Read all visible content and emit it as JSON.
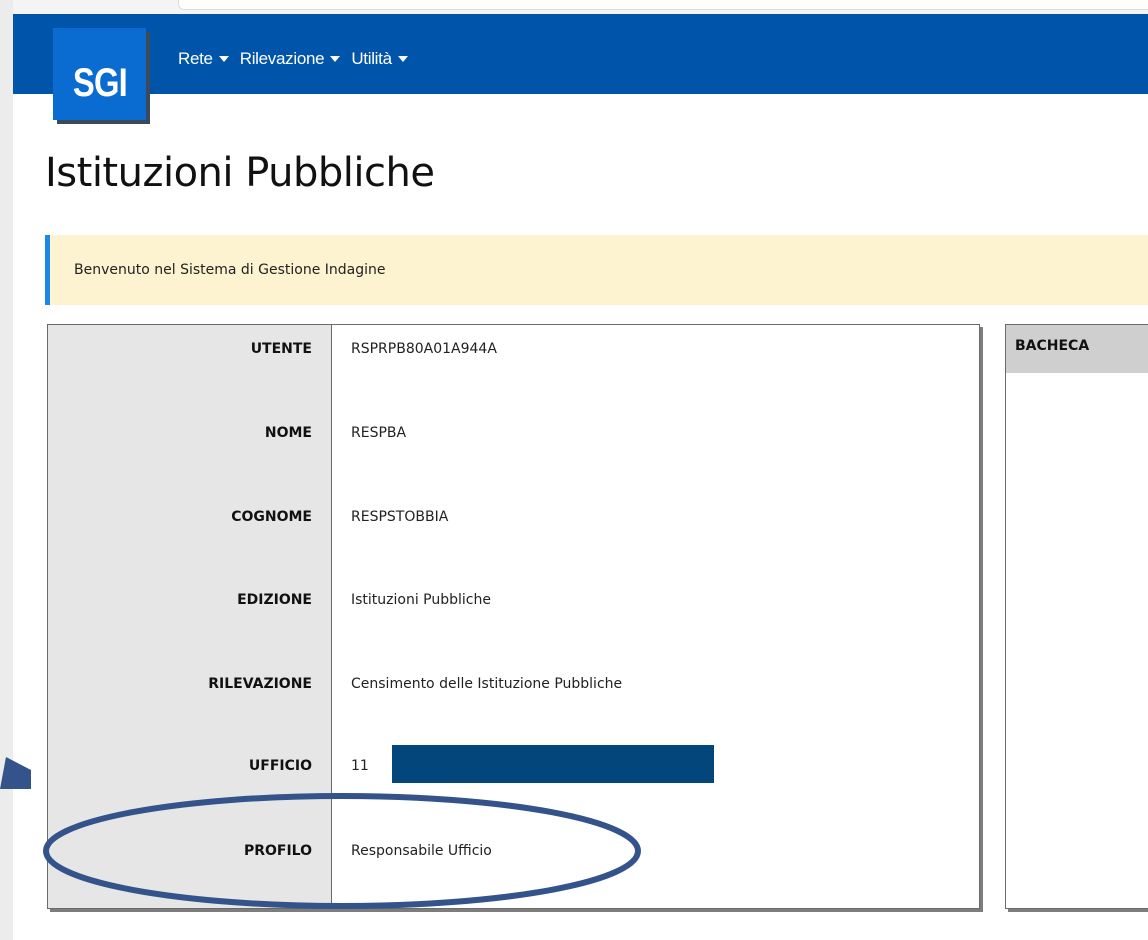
{
  "app": {
    "logo_text": "SGI"
  },
  "nav": {
    "menus": [
      {
        "label": "Rete"
      },
      {
        "label": "Rilevazione"
      },
      {
        "label": "Utilità"
      }
    ]
  },
  "page": {
    "title": "Istituzioni Pubbliche",
    "welcome": "Benvenuto nel Sistema di Gestione Indagine"
  },
  "user_info": {
    "rows": [
      {
        "label": "UTENTE",
        "value": "RSPRPB80A01A944A"
      },
      {
        "label": "NOME",
        "value": "RESPBA"
      },
      {
        "label": "COGNOME",
        "value": "RESPSTOBBIA"
      },
      {
        "label": "EDIZIONE",
        "value": "Istituzioni Pubbliche"
      },
      {
        "label": "RILEVAZIONE",
        "value": "Censimento delle Istituzione Pubbliche"
      },
      {
        "label": "UFFICIO",
        "value": "11"
      },
      {
        "label": "PROFILO",
        "value": "Responsabile Ufficio"
      }
    ]
  },
  "bacheca": {
    "title": "BACHECA"
  },
  "colors": {
    "navbar": "#0055aa",
    "logo": "#0a6bd1",
    "alert_bg": "#fdf3d0",
    "alert_border": "#1e88e5",
    "redaction": "#03467c",
    "annotation": "#34538a"
  }
}
